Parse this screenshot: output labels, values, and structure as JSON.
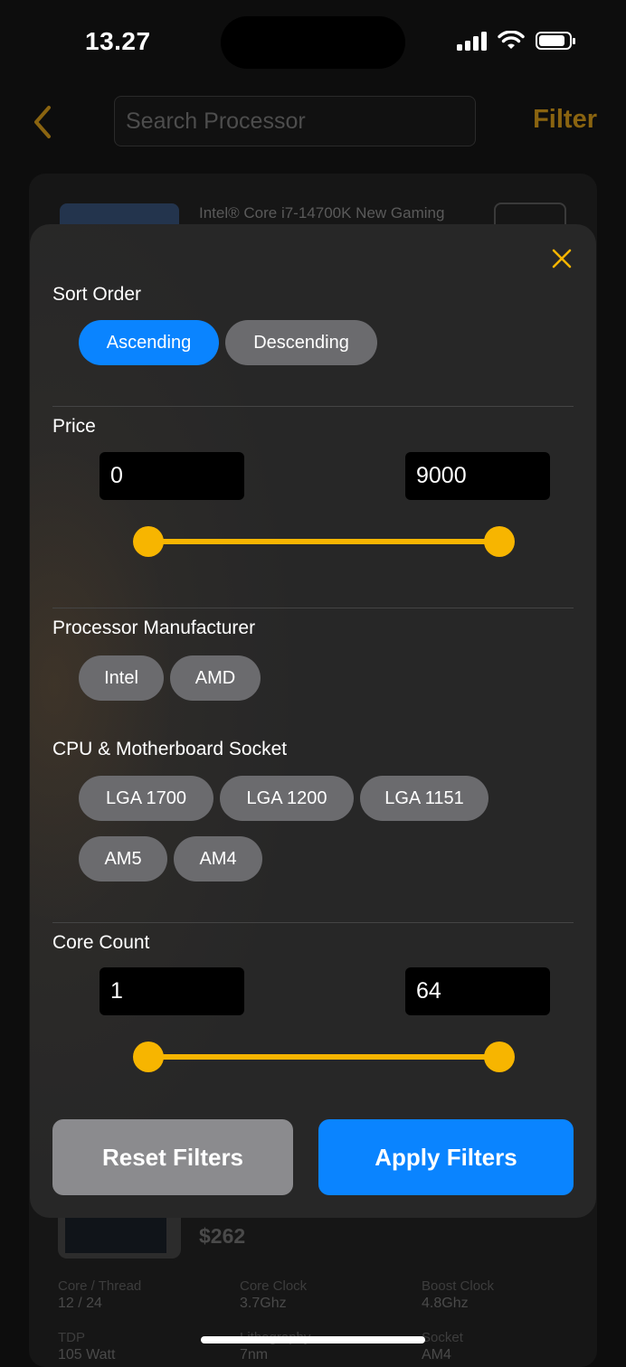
{
  "status_bar": {
    "time": "13.27"
  },
  "header": {
    "search_placeholder": "Search Processor",
    "filter_label": "Filter"
  },
  "background_product": {
    "title": "Intel® Core i7-14700K New Gaming",
    "price": "$262",
    "specs": [
      {
        "label": "Core / Thread",
        "value": "12 / 24"
      },
      {
        "label": "Core Clock",
        "value": "3.7Ghz"
      },
      {
        "label": "Boost Clock",
        "value": "4.8Ghz"
      },
      {
        "label": "TDP",
        "value": "105 Watt"
      },
      {
        "label": "Lithography",
        "value": "7nm"
      },
      {
        "label": "Socket",
        "value": "AM4"
      }
    ]
  },
  "filter_sheet": {
    "sort_order": {
      "title": "Sort Order",
      "options": [
        "Ascending",
        "Descending"
      ],
      "selected": "Ascending"
    },
    "price": {
      "title": "Price",
      "min": "0",
      "max": "9000"
    },
    "manufacturer": {
      "title": "Processor Manufacturer",
      "options": [
        "Intel",
        "AMD"
      ]
    },
    "socket": {
      "title": "CPU & Motherboard Socket",
      "options": [
        "LGA 1700",
        "LGA 1200",
        "LGA 1151",
        "AM5",
        "AM4"
      ]
    },
    "core_count": {
      "title": "Core Count",
      "min": "1",
      "max": "64"
    },
    "reset_label": "Reset Filters",
    "apply_label": "Apply Filters"
  },
  "colors": {
    "accent": "#f7b500",
    "primary": "#0a84ff",
    "chip": "#6b6b6e",
    "sheet": "#272727"
  }
}
